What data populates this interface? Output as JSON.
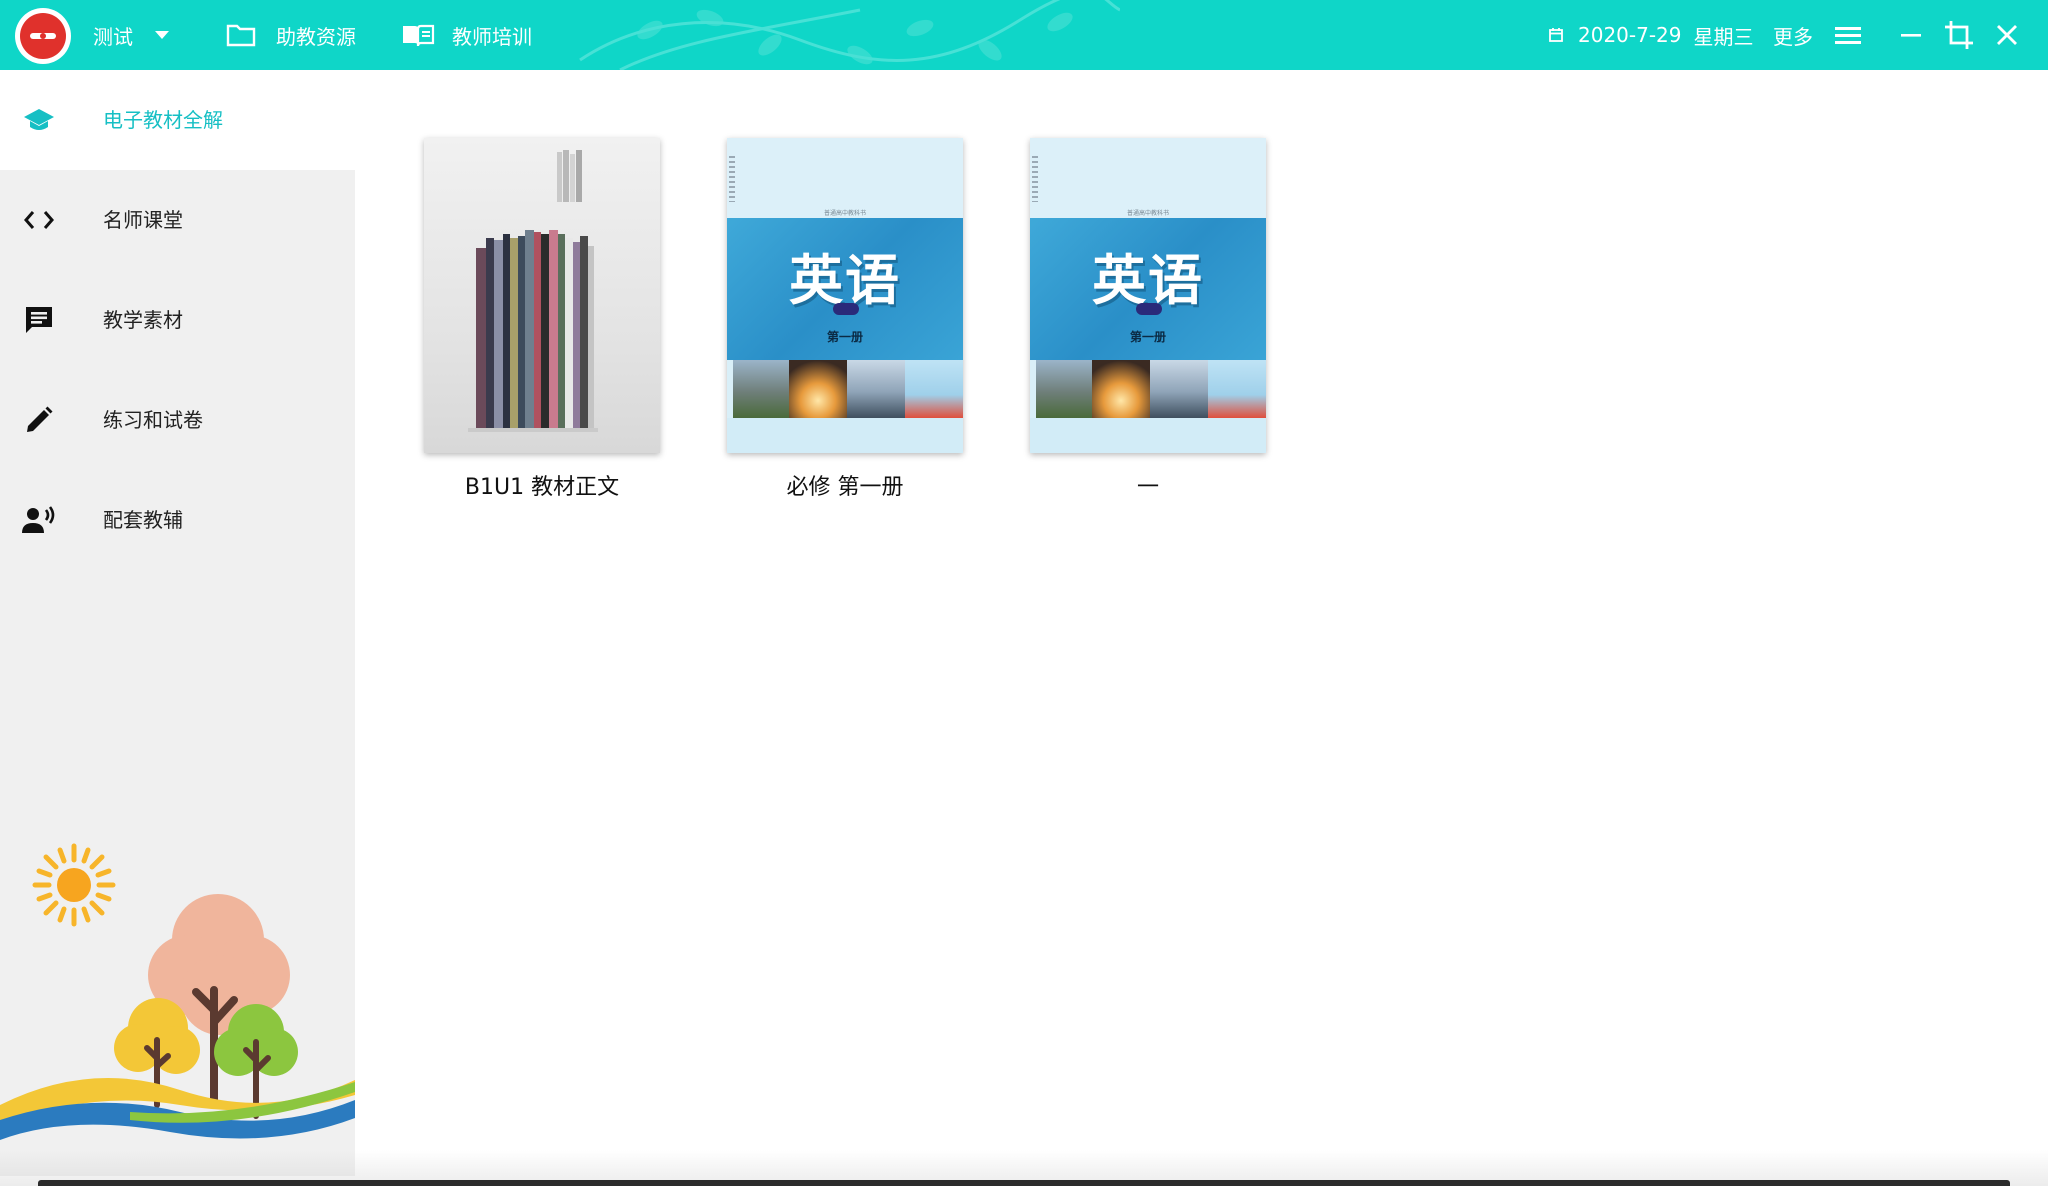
{
  "topbar": {
    "user_label": "测试",
    "nav": [
      {
        "label": "助教资源",
        "icon": "folder-icon"
      },
      {
        "label": "教师培训",
        "icon": "open-book-icon"
      }
    ],
    "date": "2020-7-29",
    "weekday": "星期三",
    "more_label": "更多",
    "brand_color": "#0fd6c8"
  },
  "sidebar": {
    "items": [
      {
        "label": "电子教材全解",
        "icon": "graduation-cap-icon",
        "active": true
      },
      {
        "label": "名师课堂",
        "icon": "code-brackets-icon",
        "active": false
      },
      {
        "label": "教学素材",
        "icon": "message-icon",
        "active": false
      },
      {
        "label": "练习和试卷",
        "icon": "pencil-icon",
        "active": false
      },
      {
        "label": "配套教辅",
        "icon": "speaker-person-icon",
        "active": false
      }
    ],
    "accent_color": "#16bfc4"
  },
  "books": [
    {
      "title": "B1U1 教材正文",
      "cover": "book-stack"
    },
    {
      "title": "必修 第一册",
      "cover": "english",
      "cover_title": "英语",
      "cover_volume": "第一册",
      "cover_series": "普通高中教科书"
    },
    {
      "title": "一",
      "cover": "english",
      "cover_title": "英语",
      "cover_volume": "第一册",
      "cover_series": "普通高中教科书"
    }
  ]
}
